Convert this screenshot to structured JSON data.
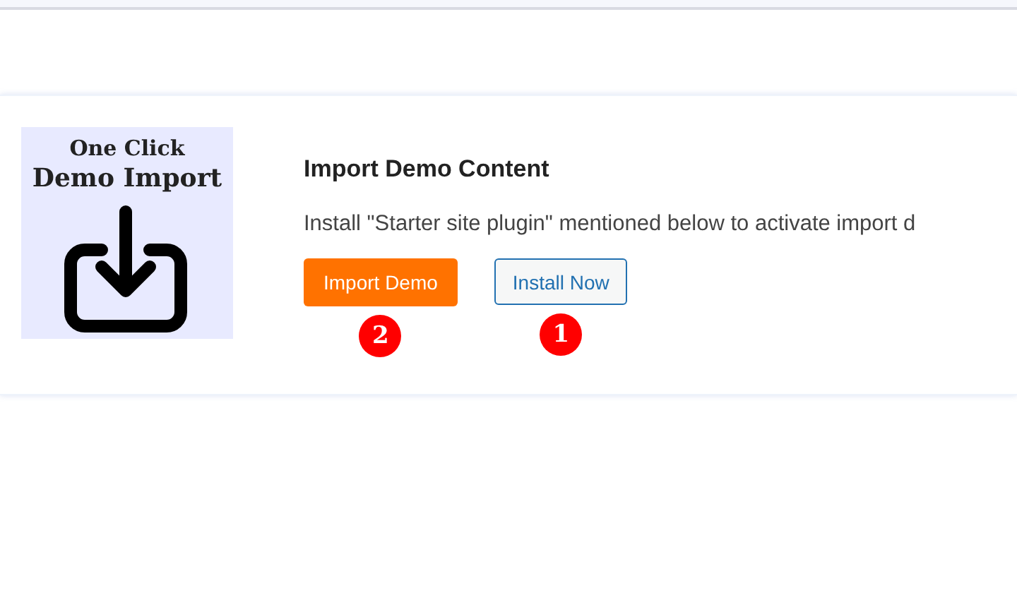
{
  "card": {
    "logo": {
      "line_1": "One Click",
      "line_2": "Demo Import"
    },
    "title": "Import Demo Content",
    "description": "Install \"Starter site plugin\" mentioned below to activate import d",
    "buttons": [
      {
        "label": "Import Demo",
        "kind": "primary",
        "badge": "2"
      },
      {
        "label": "Install Now",
        "kind": "secondary",
        "badge": "1"
      }
    ]
  }
}
